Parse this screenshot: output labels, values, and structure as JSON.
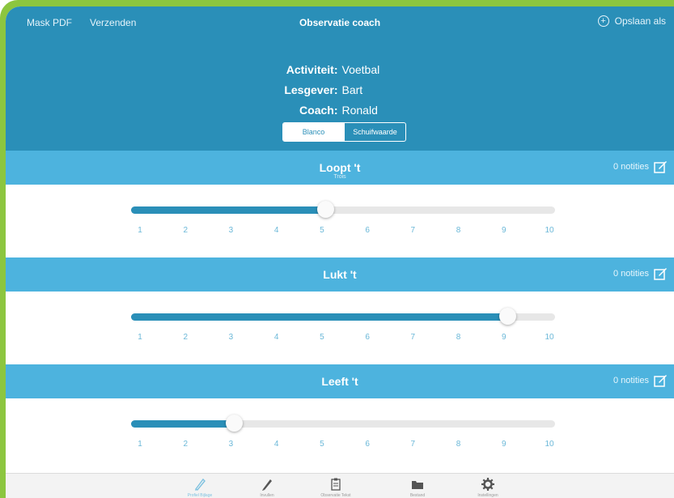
{
  "nav": {
    "left_items": [
      "Mask PDF",
      "Verzenden"
    ],
    "title": "Observatie coach",
    "right_label": "Opslaan als"
  },
  "info": {
    "rows": [
      {
        "label": "Activiteit:",
        "value": "Voetbal"
      },
      {
        "label": "Lesgever:",
        "value": "Bart"
      },
      {
        "label": "Coach:",
        "value": "Ronald"
      }
    ],
    "segment": {
      "options": [
        "Blanco",
        "Schuifwaarde"
      ],
      "selected": "Blanco"
    }
  },
  "sections": [
    {
      "title": "Loopt 't",
      "subtitle": "Trois",
      "notes": "0 notities",
      "value": 5,
      "min": 1,
      "max": 10
    },
    {
      "title": "Lukt 't",
      "subtitle": "",
      "notes": "0 notities",
      "value": 9,
      "min": 1,
      "max": 10
    },
    {
      "title": "Leeft 't",
      "subtitle": "",
      "notes": "0 notities",
      "value": 3,
      "min": 1,
      "max": 10
    }
  ],
  "scale_labels": [
    "1",
    "2",
    "3",
    "4",
    "5",
    "6",
    "7",
    "8",
    "9",
    "10"
  ],
  "toolbar": {
    "items": [
      {
        "icon": "pencil-icon",
        "label": "Profiel Bijlage",
        "active": true
      },
      {
        "icon": "pen-icon",
        "label": "Invullen",
        "active": false
      },
      {
        "icon": "clipboard-icon",
        "label": "Observatie Tekst",
        "active": false
      },
      {
        "icon": "folder-icon",
        "label": "Bestand",
        "active": false
      },
      {
        "icon": "gear-icon",
        "label": "Instellingen",
        "active": false
      }
    ]
  },
  "colors": {
    "primary": "#2a8fb8",
    "section": "#4db3de",
    "frame": "#8cc63f",
    "tick": "#6bb8d8"
  }
}
